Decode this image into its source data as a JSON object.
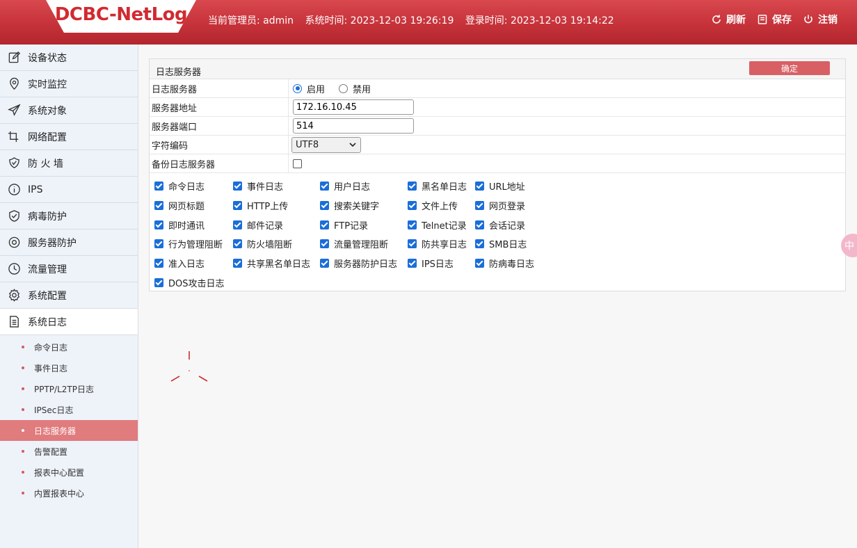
{
  "header": {
    "logo": "DCBC-NetLog",
    "admin_text": "当前管理员: admin",
    "system_time": "系统时间: 2023-12-03 19:26:19",
    "login_time": "登录时间: 2023-12-03 19:14:22",
    "actions": {
      "refresh": "刷新",
      "save": "保存",
      "logout": "注销"
    }
  },
  "sidebar": {
    "items": [
      {
        "label": "设备状态",
        "icon": "edit-icon"
      },
      {
        "label": "实时监控",
        "icon": "location-icon"
      },
      {
        "label": "系统对象",
        "icon": "send-icon"
      },
      {
        "label": "网络配置",
        "icon": "network-icon"
      },
      {
        "label": "防 火 墙",
        "icon": "firewall-icon"
      },
      {
        "label": "IPS",
        "icon": "info-icon"
      },
      {
        "label": "病毒防护",
        "icon": "shield-check-icon"
      },
      {
        "label": "服务器防护",
        "icon": "target-icon"
      },
      {
        "label": "流量管理",
        "icon": "clock-icon"
      },
      {
        "label": "系统配置",
        "icon": "gear-icon"
      },
      {
        "label": "系统日志",
        "icon": "document-icon"
      }
    ],
    "sub_items": [
      "命令日志",
      "事件日志",
      "PPTP/L2TP日志",
      "IPSec日志",
      "日志服务器",
      "告警配置",
      "报表中心配置",
      "内置报表中心"
    ]
  },
  "panel": {
    "title": "日志服务器",
    "confirm": "确定",
    "rows": {
      "log_server_label": "日志服务器",
      "enable": "启用",
      "disable": "禁用",
      "address_label": "服务器地址",
      "address_value": "172.16.10.45",
      "port_label": "服务器端口",
      "port_value": "514",
      "encoding_label": "字符编码",
      "encoding_value": "UTF8",
      "backup_label": "备份日志服务器"
    },
    "checkboxes": [
      [
        "命令日志",
        "事件日志",
        "用户日志",
        "黑名单日志",
        "URL地址"
      ],
      [
        "网页标题",
        "HTTP上传",
        "搜索关键字",
        "文件上传",
        "网页登录"
      ],
      [
        "即时通讯",
        "邮件记录",
        "FTP记录",
        "Telnet记录",
        "会话记录"
      ],
      [
        "行为管理阻断",
        "防火墙阻断",
        "流量管理阻断",
        "防共享日志",
        "SMB日志"
      ],
      [
        "准入日志",
        "共享黑名单日志",
        "服务器防护日志",
        "IPS日志",
        "防病毒日志"
      ],
      [
        "DOS攻击日志"
      ]
    ]
  },
  "float_widget": "中"
}
